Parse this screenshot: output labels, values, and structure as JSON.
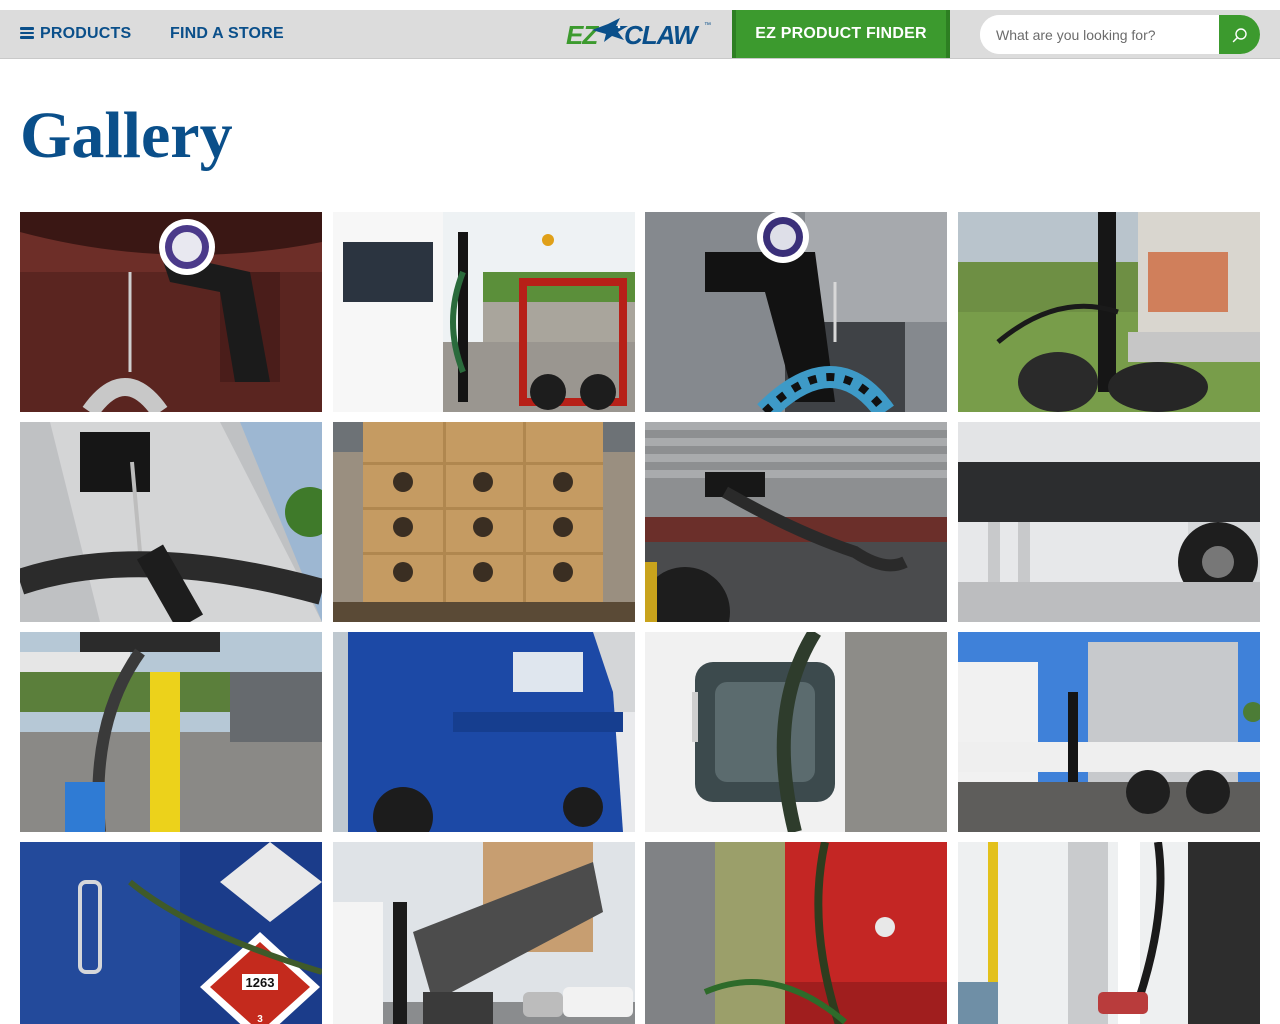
{
  "nav": {
    "products_label": "PRODUCTS",
    "find_store_label": "FIND A STORE",
    "finder_label": "EZ PRODUCT FINDER",
    "search_placeholder": "What are you looking for?"
  },
  "logo": {
    "ez": "EZ",
    "claw": "CLAW",
    "tm": "™"
  },
  "page": {
    "title": "Gallery"
  },
  "gallery_photos": [
    {
      "name": "photo-ez-claw-bracket-red-truck"
    },
    {
      "name": "photo-white-truck-cab-with-claw-pole"
    },
    {
      "name": "photo-ez-claw-bracket-gray-cab"
    },
    {
      "name": "photo-truck-rear-hoses-on-claw"
    },
    {
      "name": "photo-carabiner-hose-hanger"
    },
    {
      "name": "photo-pallet-of-boxes"
    },
    {
      "name": "photo-hose-under-trailer"
    },
    {
      "name": "photo-trailer-underside-hoses"
    },
    {
      "name": "photo-propane-station-hose"
    },
    {
      "name": "photo-blue-semi-truck"
    },
    {
      "name": "photo-white-cab-hose-window"
    },
    {
      "name": "photo-silver-truck-hoses"
    },
    {
      "name": "photo-blue-cab-hazmat-placard"
    },
    {
      "name": "photo-tipped-truck-frame"
    },
    {
      "name": "photo-red-cab-hoses"
    },
    {
      "name": "photo-fuel-pump-nozzle"
    }
  ],
  "placard_text": {
    "number": "1263",
    "class": "3"
  },
  "colors": {
    "brand_blue": "#0a4f8a",
    "brand_green": "#3c9a2e",
    "nav_bg": "#dcdcdc"
  }
}
